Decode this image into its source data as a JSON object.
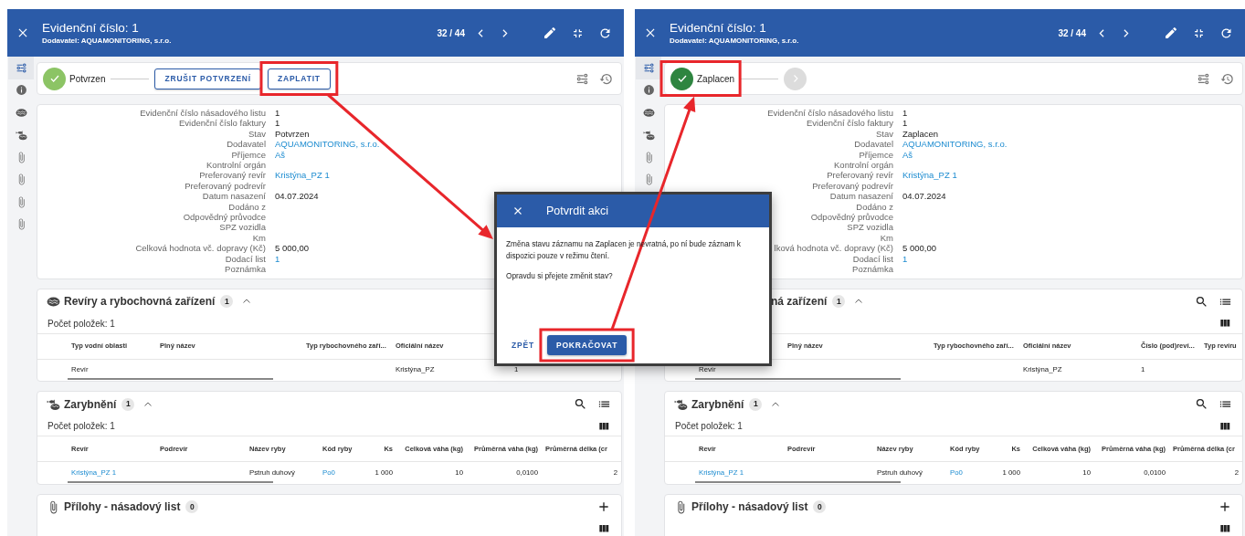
{
  "panels": [
    {
      "header": {
        "title": "Evidenční číslo: 1",
        "subtitle": "Dodavatel: AQUAMONITORING, s.r.o.",
        "pager": "32 / 44"
      },
      "rail": [
        {
          "kind": "workflow",
          "selected": true
        },
        {
          "kind": "info",
          "selected": false
        },
        {
          "kind": "waters",
          "selected": false
        },
        {
          "kind": "stocking",
          "selected": false
        },
        {
          "kind": "attachment",
          "selected": false
        },
        {
          "kind": "attachment",
          "selected": false
        },
        {
          "kind": "attachment",
          "selected": false
        },
        {
          "kind": "attachment",
          "selected": false
        }
      ],
      "workflow": {
        "steps": [
          {
            "label": "Potvrzen",
            "kind": "done"
          }
        ],
        "actions": [
          "ZRUŠIT POTVRZENÍ",
          "ZAPLATIT"
        ]
      },
      "details": [
        {
          "label": "Evidenční číslo násadového listu",
          "value": "1"
        },
        {
          "label": "Evidenční číslo faktury",
          "value": "1"
        },
        {
          "label": "Stav",
          "value": "Potvrzen"
        },
        {
          "label": "Dodavatel",
          "value": "AQUAMONITORING, s.r.o.",
          "link": true
        },
        {
          "label": "Příjemce",
          "value": "Aš",
          "link": true
        },
        {
          "label": "Kontrolní orgán"
        },
        {
          "label": "Preferovaný revír",
          "value": "Kristýna_PZ 1",
          "link": true
        },
        {
          "label": "Preferovaný podrevír"
        },
        {
          "label": "Datum nasazení",
          "value": "04.07.2024"
        },
        {
          "label": "Dodáno z"
        },
        {
          "label": "Odpovědný průvodce"
        },
        {
          "label": "SPZ vozidla"
        },
        {
          "label": "Km"
        },
        {
          "label": "Celková hodnota vč. dopravy (Kč)",
          "value": "5 000,00"
        },
        {
          "label": "Dodací list",
          "value": "1",
          "link": true
        },
        {
          "label": "Poznámka"
        }
      ],
      "sections": [
        {
          "title": "Revíry a rybochovná zařízení",
          "count": "1",
          "collapse_toggle": true,
          "count_label": "Počet položek: 1",
          "columns_toggle": false,
          "table": {
            "columns": [
              {
                "label": "Typ vodní oblasti"
              },
              {
                "label": "Plný název"
              },
              {
                "label": "Typ rybochovného zaří..."
              },
              {
                "label": "Oficiální název"
              },
              {}
            ],
            "rows": [
              [
                {
                  "text": "Revír"
                },
                null,
                null,
                {
                  "text": "Kristýna_PZ"
                },
                {
                  "text": "1"
                }
              ]
            ]
          }
        },
        {
          "title": "Zarybnění",
          "count": "1",
          "collapse_toggle": true,
          "tools": [
            {
              "kind": "search"
            },
            {
              "kind": "list"
            }
          ],
          "count_label": "Počet položek: 1",
          "columns_toggle": true,
          "table": {
            "columns": [
              {
                "label": "Revír"
              },
              {
                "label": "Podrevír"
              },
              {
                "label": "Název ryby"
              },
              {
                "label": "Kód ryby"
              },
              {
                "label": "Ks"
              },
              {
                "label": "Celková váha (kg)"
              },
              {
                "label": "Průměrná váha (kg)"
              },
              {
                "label": "Průměrná délka (cr"
              }
            ],
            "rows": [
              [
                {
                  "text": "Kristýna_PZ 1",
                  "link": true
                },
                null,
                {
                  "text": "Pstruh duhový"
                },
                {
                  "text": "Po0",
                  "link": true
                },
                {
                  "text": "1 000"
                },
                {
                  "text": "10"
                },
                {
                  "text": "0,0100"
                },
                {
                  "text": "2"
                }
              ]
            ]
          }
        },
        {
          "title": "Přílohy - násadový list",
          "count": "0",
          "collapse_toggle": false,
          "tools": [
            {
              "kind": "plus"
            }
          ],
          "columns_toggle": true
        }
      ]
    },
    {
      "header": {
        "title": "Evidenční číslo: 1",
        "subtitle": "Dodavatel: AQUAMONITORING, s.r.o.",
        "pager": "32 / 44"
      },
      "rail": [
        {
          "kind": "workflow",
          "selected": true
        },
        {
          "kind": "info",
          "selected": false
        },
        {
          "kind": "waters",
          "selected": false
        },
        {
          "kind": "stocking",
          "selected": false
        },
        {
          "kind": "attachment",
          "selected": false
        },
        {
          "kind": "attachment",
          "selected": false
        }
      ],
      "workflow": {
        "steps": [
          {
            "label": "Zaplacen",
            "kind": "final"
          },
          {
            "kind": "next"
          }
        ]
      },
      "details": [
        {
          "label": "Evidenční číslo násadového listu",
          "value": "1"
        },
        {
          "label": "Evidenční číslo faktury",
          "value": "1"
        },
        {
          "label": "Stav",
          "value": "Zaplacen"
        },
        {
          "label": "Dodavatel",
          "value": "AQUAMONITORING, s.r.o.",
          "link": true
        },
        {
          "label": "Příjemce",
          "value": "Aš",
          "link": true
        },
        {
          "label": "Kontrolní orgán"
        },
        {
          "label": "Preferovaný revír",
          "value": "Kristýna_PZ 1",
          "link": true
        },
        {
          "label": "Preferovaný podrevír"
        },
        {
          "label": "Datum nasazení",
          "value": "04.07.2024"
        },
        {
          "label": "Dodáno z"
        },
        {
          "label": "Odpovědný průvodce"
        },
        {
          "label": "SPZ vozidla"
        },
        {
          "label": "Km"
        },
        {
          "label": "lková hodnota vč. dopravy (Kč)",
          "value": "5 000,00"
        },
        {
          "label": "Dodací list",
          "value": "1",
          "link": true
        },
        {
          "label": "Poznámka"
        }
      ],
      "sections": [
        {
          "hidden_by_dialog": true,
          "title": "ná zařízení",
          "count": "1",
          "collapse_toggle": true,
          "tools": [
            {
              "kind": "search"
            },
            {
              "kind": "list"
            }
          ],
          "columns_toggle": true,
          "table": {
            "columns": [
              {},
              {
                "label": "Plný název"
              },
              {
                "label": "Typ rybochovného zaří..."
              },
              {
                "label": "Oficiální název"
              },
              {
                "label": "Číslo (pod)reví..."
              },
              {
                "label": "Typ revíru"
              }
            ],
            "rows": [
              [
                {
                  "text": "Revír"
                },
                null,
                null,
                {
                  "text": "Kristýna_PZ"
                },
                {
                  "text": "1"
                },
                null
              ]
            ]
          }
        },
        {
          "title": "Zarybnění",
          "count": "1",
          "collapse_toggle": true,
          "tools": [
            {
              "kind": "search"
            },
            {
              "kind": "list"
            }
          ],
          "count_label": "Počet položek: 1",
          "columns_toggle": true,
          "table": {
            "columns": [
              {
                "label": "Revír"
              },
              {
                "label": "Podrevír"
              },
              {
                "label": "Název ryby"
              },
              {
                "label": "Kód ryby"
              },
              {
                "label": "Ks"
              },
              {
                "label": "Celková váha (kg)"
              },
              {
                "label": "Průměrná váha (kg)"
              },
              {
                "label": "Průměrná délka (cr"
              }
            ],
            "rows": [
              [
                {
                  "text": "Kristýna_PZ 1",
                  "link": true
                },
                null,
                {
                  "text": "Pstruh duhový"
                },
                {
                  "text": "Po0",
                  "link": true
                },
                {
                  "text": "1 000"
                },
                {
                  "text": "10"
                },
                {
                  "text": "0,0100"
                },
                {
                  "text": "2"
                }
              ]
            ]
          }
        },
        {
          "title": "Přílohy - násadový list",
          "count": "0",
          "collapse_toggle": false,
          "tools": [
            {
              "kind": "plus"
            }
          ],
          "columns_toggle": true
        }
      ]
    }
  ],
  "dialog": {
    "title": "Potvrdit akci",
    "paragraphs": [
      "Změna stavu záznamu na Zaplacen je nevratná, po ní bude záznam k dispozici pouze v režimu čtení.",
      "Opravdu si přejete změnit stav?"
    ],
    "buttons": [
      {
        "label": "ZPĚT",
        "kind": "text"
      },
      {
        "label": "POKRAČOVAT",
        "kind": "primary"
      }
    ]
  }
}
